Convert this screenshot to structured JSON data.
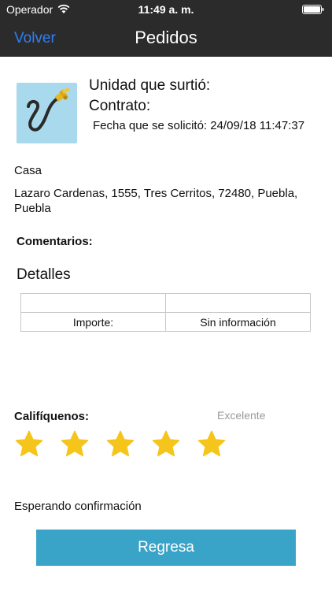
{
  "status_bar": {
    "carrier": "Operador",
    "time": "11:49 a. m."
  },
  "nav": {
    "back_label": "Volver",
    "title": "Pedidos"
  },
  "order": {
    "unit_label": "Unidad que surtió:",
    "contract_label": "Contrato:",
    "date_label": "Fecha que se solicitó:",
    "date_value": "24/09/18 11:47:37"
  },
  "address": {
    "type": "Casa",
    "line": "Lazaro Cardenas, 1555, Tres Cerritos, 72480, Puebla, Puebla"
  },
  "comments": {
    "label": "Comentarios:"
  },
  "details": {
    "title": "Detalles",
    "rows": [
      {
        "label": "",
        "value": ""
      },
      {
        "label": "Importe:",
        "value": "Sin información"
      }
    ]
  },
  "rating": {
    "label": "Califíquenos:",
    "caption": "Excelente",
    "value": 5,
    "max": 5,
    "star_color": "#f5c51b"
  },
  "status_text": "Esperando confirmación",
  "action": {
    "button_label": "Regresa",
    "button_color": "#3aa3c8"
  }
}
